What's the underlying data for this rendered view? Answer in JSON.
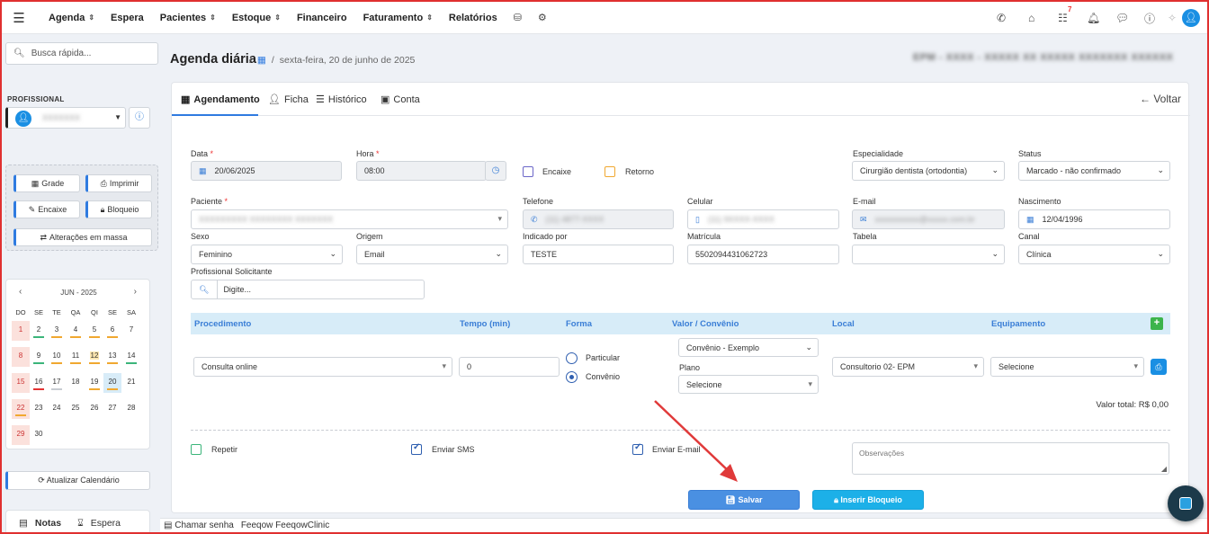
{
  "nav": {
    "items": [
      {
        "label": "Agenda",
        "chevron": true
      },
      {
        "label": "Espera",
        "chevron": false
      },
      {
        "label": "Pacientes",
        "chevron": true
      },
      {
        "label": "Estoque",
        "chevron": true
      },
      {
        "label": "Financeiro",
        "chevron": false
      },
      {
        "label": "Faturamento",
        "chevron": true
      },
      {
        "label": "Relatórios",
        "chevron": false
      }
    ],
    "task_badge": "7"
  },
  "sidebar": {
    "search_placeholder": "Busca rápida...",
    "professional_label": "PROFISSIONAL",
    "professional_value": "XXXXXXX",
    "buttons": {
      "grade": "Grade",
      "imprimir": "Imprimir",
      "encaixe": "Encaixe",
      "bloqueio": "Bloqueio",
      "alteracoes": "Alterações em massa"
    },
    "calendar": {
      "month": "JUN - 2025",
      "dow": [
        "DO",
        "SE",
        "TE",
        "QA",
        "QI",
        "SE",
        "SA"
      ],
      "weeks": [
        [
          "1",
          "2",
          "3",
          "4",
          "5",
          "6",
          "7"
        ],
        [
          "8",
          "9",
          "10",
          "11",
          "12",
          "13",
          "14"
        ],
        [
          "15",
          "16",
          "17",
          "18",
          "19",
          "20",
          "21"
        ],
        [
          "22",
          "23",
          "24",
          "25",
          "26",
          "27",
          "28"
        ],
        [
          "29",
          "30",
          "",
          "",
          "",
          "",
          ""
        ]
      ]
    },
    "update_button": "Atualizar Calendário",
    "notas": "Notas",
    "espera": "Espera"
  },
  "header": {
    "title": "Agenda diária",
    "date": "sexta-feira, 20 de junho de 2025",
    "blurred_name": "EPM - XXXX - XXXXX XX XXXXX XXXXXXX XXXXXX"
  },
  "tabs": {
    "agendamento": "Agendamento",
    "ficha": "Ficha",
    "historico": "Histórico",
    "conta": "Conta",
    "voltar": "Voltar"
  },
  "form": {
    "data_label": "Data",
    "data_value": "20/06/2025",
    "hora_label": "Hora",
    "hora_value": "08:00",
    "encaixe": "Encaixe",
    "retorno": "Retorno",
    "especialidade_label": "Especialidade",
    "especialidade_value": "Cirurgião dentista (ortodontia)",
    "status_label": "Status",
    "status_value": "Marcado - não confirmado",
    "paciente_label": "Paciente",
    "paciente_value": "XXXXXXXXX XXXXXXXX XXXXXXX",
    "telefone_label": "Telefone",
    "telefone_value": "(11) 4877-XXXX",
    "celular_label": "Celular",
    "celular_value": "(11) 9XXXX-XXXX",
    "email_label": "E-mail",
    "email_value": "xxxxxxxxxxx@xxxxx.com.br",
    "nascimento_label": "Nascimento",
    "nascimento_value": "12/04/1996",
    "sexo_label": "Sexo",
    "sexo_value": "Feminino",
    "origem_label": "Origem",
    "origem_value": "Email",
    "indicado_label": "Indicado por",
    "indicado_value": "TESTE",
    "matricula_label": "Matrícula",
    "matricula_value": "5502094431062723",
    "tabela_label": "Tabela",
    "tabela_value": "",
    "canal_label": "Canal",
    "canal_value": "Clínica",
    "solicitante_label": "Profissional Solicitante",
    "solicitante_placeholder": "Digite..."
  },
  "procedure": {
    "headers": [
      "Procedimento",
      "Tempo (min)",
      "Forma",
      "Valor / Convênio",
      "Local",
      "Equipamento"
    ],
    "procedimento_value": "Consulta online",
    "tempo_value": "0",
    "forma_particular": "Particular",
    "forma_convenio": "Convênio",
    "convenio_value": "Convênio - Exemplo",
    "plano_label": "Plano",
    "plano_value": "Selecione",
    "local_value": "Consultorio 02- EPM",
    "equipamento_value": "Selecione",
    "valor_total": "Valor total: R$ 0,00"
  },
  "options": {
    "repetir": "Repetir",
    "enviar_sms": "Enviar SMS",
    "enviar_email": "Enviar E-mail",
    "observacoes_placeholder": "Observações"
  },
  "actions": {
    "salvar": "Salvar",
    "inserir_bloqueio": "Inserir Bloqueio"
  },
  "footer": {
    "chamar_senha": "Chamar senha",
    "brand": "Feeqow FeeqowClinic"
  },
  "colors": {
    "accent": "#2f7be0",
    "required": "#e33333",
    "proc_header_bg": "#d7ecf8",
    "annotation_arrow": "#e03a3a"
  }
}
